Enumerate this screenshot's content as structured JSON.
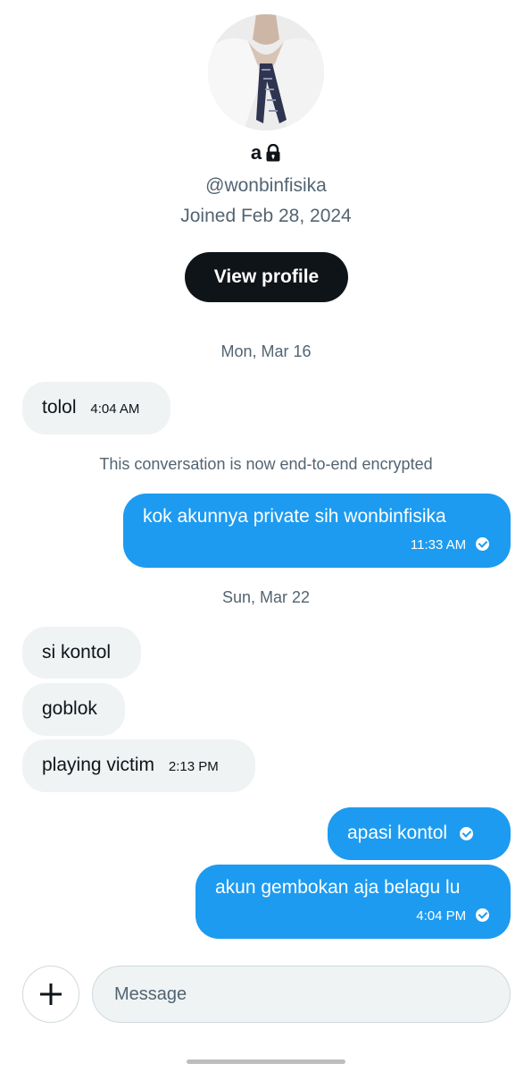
{
  "profile": {
    "name": "a",
    "handle": "@wonbinfisika",
    "joined": "Joined Feb 28, 2024",
    "view_profile_label": "View profile"
  },
  "conversation": {
    "date1": "Mon, Mar 16",
    "msg1": {
      "text": "tolol",
      "time": "4:04 AM"
    },
    "encrypted_notice": "This conversation is now end-to-end encrypted",
    "msg2": {
      "text": "kok akunnya private sih wonbinfisika",
      "time": "11:33 AM"
    },
    "date2": "Sun, Mar 22",
    "msg3": {
      "text": "si kontol"
    },
    "msg4": {
      "text": "goblok"
    },
    "msg5": {
      "text": "playing victim",
      "time": "2:13 PM"
    },
    "msg6": {
      "text": "apasi kontol"
    },
    "msg7": {
      "text": "akun gembokan aja belagu lu",
      "time": "4:04 PM"
    }
  },
  "composer": {
    "placeholder": "Message"
  },
  "icons": {
    "lock": "lock-icon",
    "check": "check-icon",
    "plus": "plus-icon"
  },
  "colors": {
    "accent": "#1d9bf0",
    "received_bubble": "#eff3f4",
    "secondary_text": "#536471",
    "button_dark": "#0f1419"
  }
}
